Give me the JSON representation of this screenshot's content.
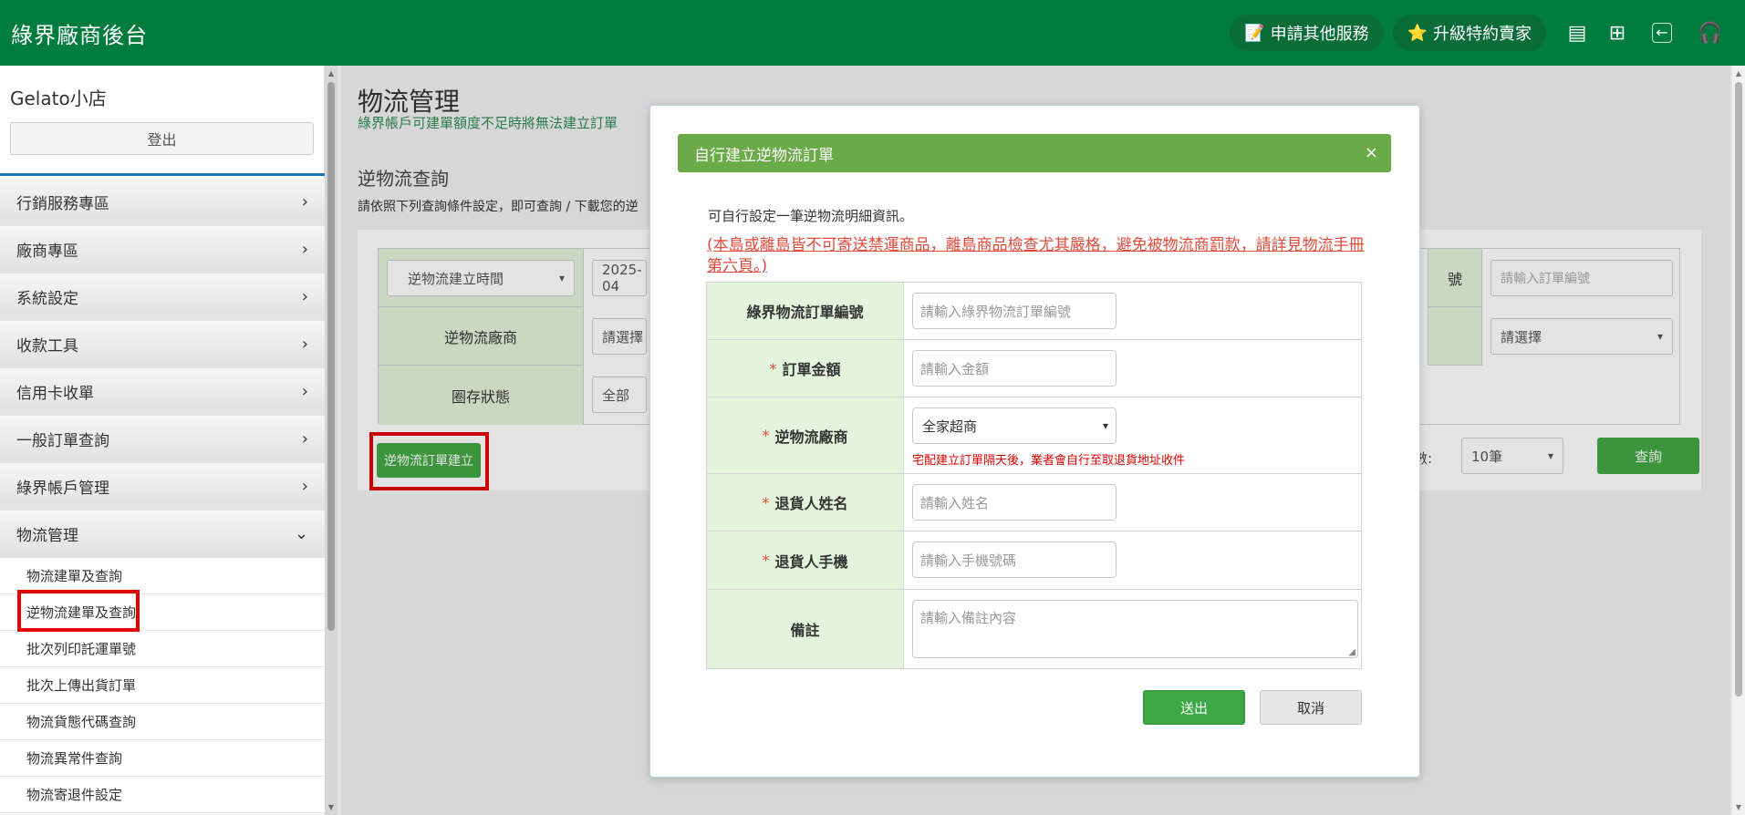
{
  "header": {
    "brand": "綠界廠商後台",
    "apply_services": "申請其他服務",
    "upgrade_seller": "升級特約賣家"
  },
  "sidebar": {
    "shop_name": "Gelato小店",
    "logout": "登出",
    "menu": [
      {
        "label": "行銷服務專區"
      },
      {
        "label": "廠商專區"
      },
      {
        "label": "系統設定"
      },
      {
        "label": "收款工具"
      },
      {
        "label": "信用卡收單"
      },
      {
        "label": "一般訂單查詢"
      },
      {
        "label": "綠界帳戶管理"
      },
      {
        "label": "物流管理"
      }
    ],
    "submenu": [
      {
        "label": "物流建單及查詢"
      },
      {
        "label": "逆物流建單及查詢"
      },
      {
        "label": "批次列印託運單號"
      },
      {
        "label": "批次上傳出貨訂單"
      },
      {
        "label": "物流貨態代碼查詢"
      },
      {
        "label": "物流異常件查詢"
      },
      {
        "label": "物流寄退件設定"
      }
    ]
  },
  "main": {
    "title": "物流管理",
    "subtitle": "綠界帳戶可建單額度不足時將無法建立訂單",
    "section_title": "逆物流查詢",
    "section_desc": "請依照下列查詢條件設定，即可查詢 / 下載您的逆",
    "filters": {
      "time_select": "逆物流建立時間",
      "date_value": "2025-04",
      "vendor_label": "逆物流廠商",
      "vendor_select": "請選擇",
      "storage_label": "圈存狀態",
      "storage_select": "全部",
      "order_no_suffix": "號",
      "order_no_placeholder": "請輸入訂單編號",
      "right_select": "請選擇"
    },
    "create_button": "逆物流訂單建立",
    "count_label": "數:",
    "count_value": "10筆",
    "query_button": "查詢"
  },
  "modal": {
    "title": "自行建立逆物流訂單",
    "close": "×",
    "intro": "可自行設定一筆逆物流明細資訊。",
    "warning": "(本島或離島皆不可寄送禁運商品，離島商品檢查尤其嚴格，避免被物流商罰款，請詳見物流手冊第六頁。)",
    "fields": {
      "order_no_label": "綠界物流訂單編號",
      "order_no_placeholder": "請輸入綠界物流訂單編號",
      "amount_label": "訂單金額",
      "amount_placeholder": "請輸入金額",
      "vendor_label": "逆物流廠商",
      "vendor_value": "全家超商",
      "vendor_note": "宅配建立訂單隔天後，業者會自行至取退貨地址收件",
      "name_label": "退貨人姓名",
      "name_placeholder": "請輸入姓名",
      "phone_label": "退貨人手機",
      "phone_placeholder": "請輸入手機號碼",
      "note_label": "備註",
      "note_placeholder": "請輸入備註內容",
      "required_mark": "*"
    },
    "submit": "送出",
    "cancel": "取消"
  }
}
